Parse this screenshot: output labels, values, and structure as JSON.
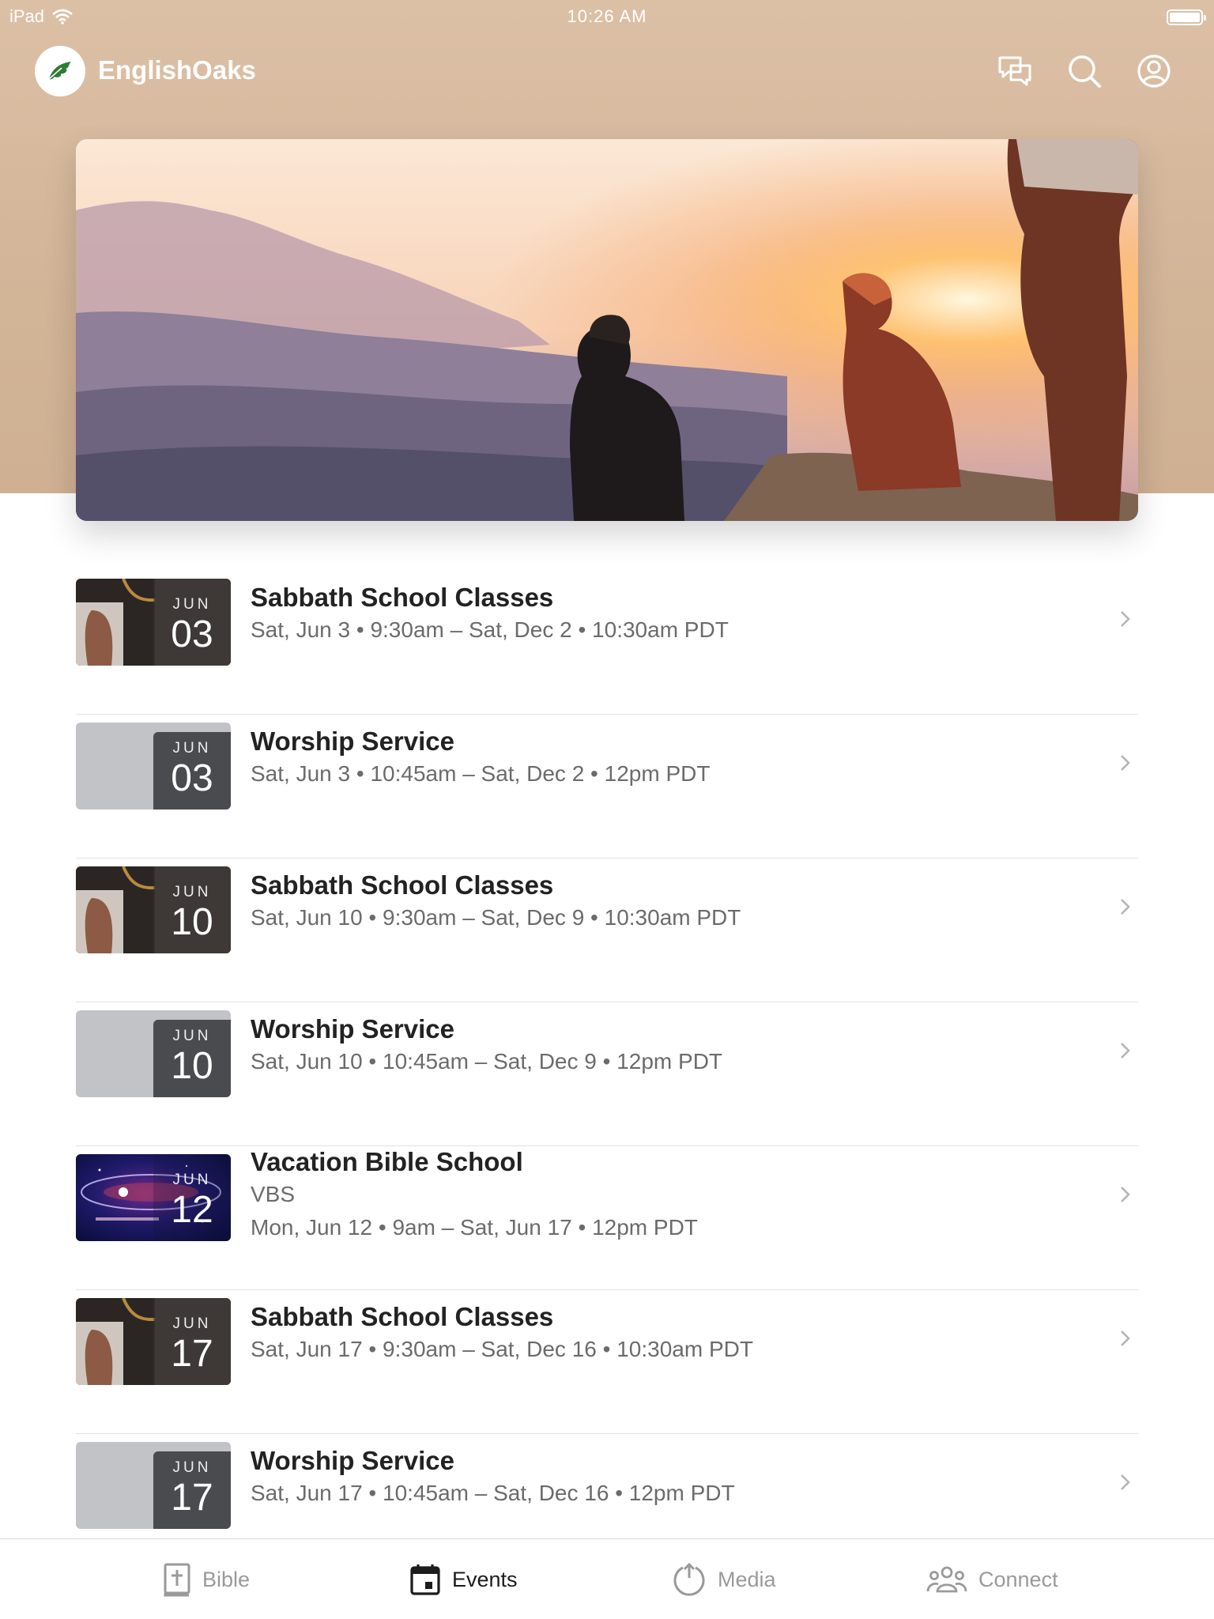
{
  "status_bar": {
    "device": "iPad",
    "time": "10:26 AM"
  },
  "app": {
    "title": "EnglishOaks"
  },
  "nav_icons": [
    "chat-icon",
    "search-icon",
    "profile-icon"
  ],
  "events": [
    {
      "month": "JUN",
      "day": "03",
      "title": "Sabbath School Classes",
      "lines": [
        "Sat, Jun 3 • 9:30am – Sat, Dec 2 • 10:30am PDT"
      ],
      "thumb": "photo"
    },
    {
      "month": "JUN",
      "day": "03",
      "title": "Worship Service",
      "lines": [
        "Sat, Jun 3 • 10:45am – Sat, Dec 2 • 12pm PDT"
      ],
      "thumb": "plain"
    },
    {
      "month": "JUN",
      "day": "10",
      "title": "Sabbath School Classes",
      "lines": [
        "Sat, Jun 10 • 9:30am – Sat, Dec 9 • 10:30am PDT"
      ],
      "thumb": "photo"
    },
    {
      "month": "JUN",
      "day": "10",
      "title": "Worship Service",
      "lines": [
        "Sat, Jun 10 • 10:45am – Sat, Dec 9 • 12pm PDT"
      ],
      "thumb": "plain"
    },
    {
      "month": "JUN",
      "day": "12",
      "title": "Vacation Bible School",
      "lines": [
        "VBS",
        "Mon, Jun 12 • 9am – Sat, Jun 17 • 12pm PDT"
      ],
      "thumb": "vbs"
    },
    {
      "month": "JUN",
      "day": "17",
      "title": "Sabbath School Classes",
      "lines": [
        "Sat, Jun 17 • 9:30am – Sat, Dec 16 • 10:30am PDT"
      ],
      "thumb": "photo"
    },
    {
      "month": "JUN",
      "day": "17",
      "title": "Worship Service",
      "lines": [
        "Sat, Jun 17 • 10:45am – Sat, Dec 16 • 12pm PDT"
      ],
      "thumb": "plain"
    }
  ],
  "tabs": [
    {
      "label": "Bible",
      "icon": "bible-icon",
      "active": false
    },
    {
      "label": "Events",
      "icon": "calendar-icon",
      "active": true
    },
    {
      "label": "Media",
      "icon": "media-icon",
      "active": false
    },
    {
      "label": "Connect",
      "icon": "people-icon",
      "active": false
    }
  ],
  "colors": {
    "header_band": "#d2b497",
    "active_tab": "#1c1c1c",
    "inactive_tab": "#9a9a9a",
    "logo_leaf": "#2e7d32"
  }
}
